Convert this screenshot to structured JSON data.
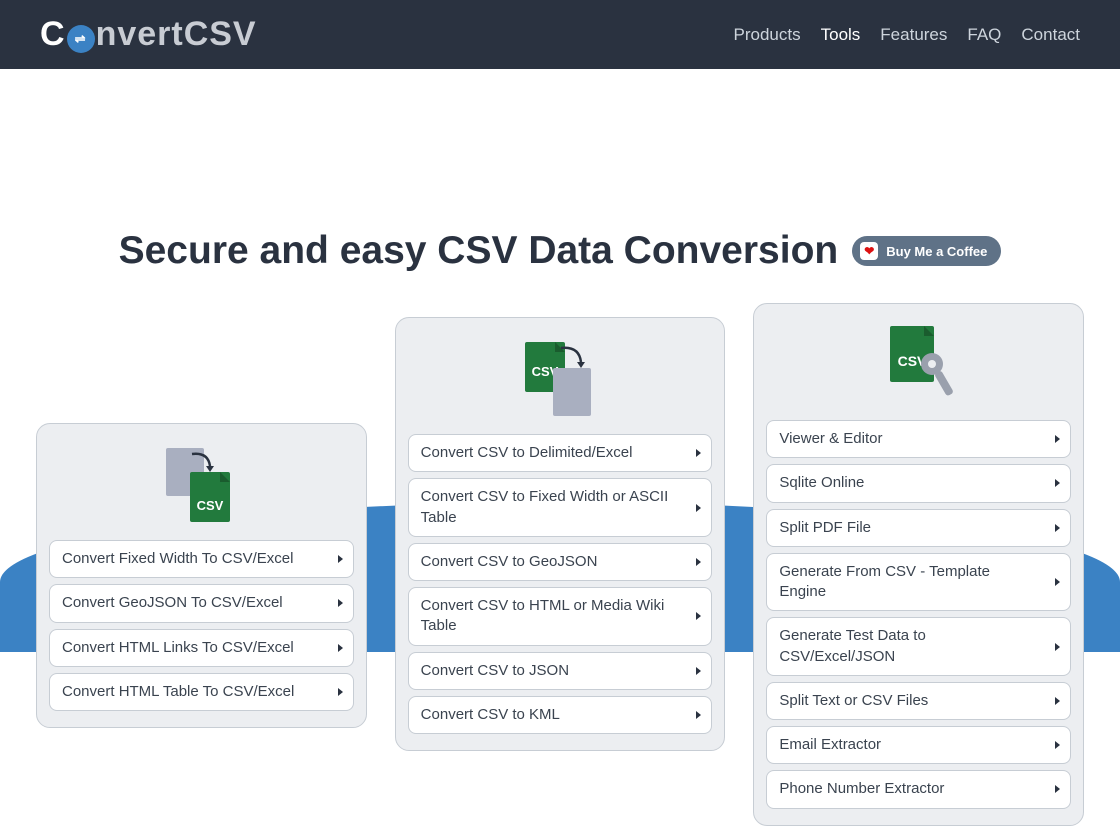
{
  "header": {
    "logo_prefix": "C",
    "logo_glyph": "⇌",
    "logo_suffix": "nvertCSV",
    "nav": [
      "Products",
      "Tools",
      "Features",
      "FAQ",
      "Contact"
    ],
    "active_index": 1
  },
  "hero": {
    "title": "Secure and easy CSV Data Conversion",
    "donate_label": "Buy Me a Coffee",
    "donate_icon": "❤"
  },
  "cards": [
    {
      "icon": "to-csv-icon",
      "items": [
        "Convert Fixed Width To CSV/Excel",
        "Convert GeoJSON To CSV/Excel",
        "Convert HTML Links To CSV/Excel",
        "Convert HTML Table To CSV/Excel"
      ]
    },
    {
      "icon": "from-csv-icon",
      "items": [
        "Convert CSV to Delimited/Excel",
        "Convert CSV to Fixed Width or ASCII Table",
        "Convert CSV to GeoJSON",
        "Convert CSV to HTML or Media Wiki Table",
        "Convert CSV to JSON",
        "Convert CSV to KML"
      ]
    },
    {
      "icon": "csv-tools-icon",
      "items": [
        "Viewer & Editor",
        "Sqlite Online",
        "Split PDF File",
        "Generate From CSV - Template Engine",
        "Generate Test Data to CSV/Excel/JSON",
        "Split Text or CSV Files",
        "Email Extractor",
        "Phone Number Extractor"
      ]
    }
  ]
}
